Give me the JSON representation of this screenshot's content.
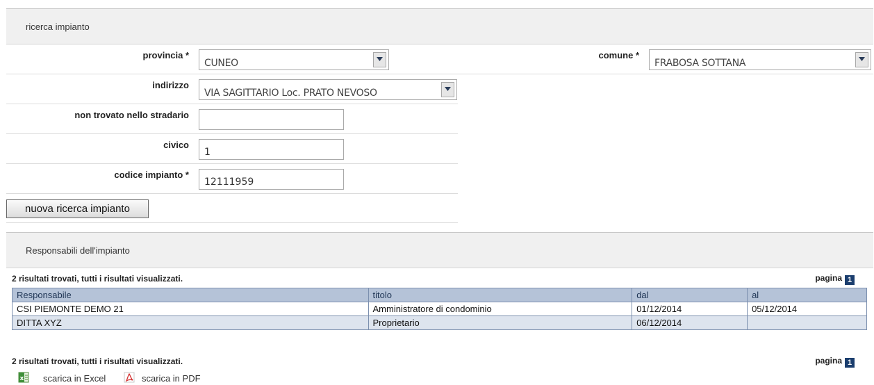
{
  "search": {
    "header": "ricerca impianto",
    "provincia": {
      "label": "provincia *",
      "value": "CUNEO"
    },
    "comune": {
      "label": "comune *",
      "value": "FRABOSA SOTTANA"
    },
    "indirizzo": {
      "label": "indirizzo",
      "value": "VIA SAGITTARIO Loc. PRATO NEVOSO"
    },
    "non_trovato": {
      "label": "non trovato nello stradario",
      "value": ""
    },
    "civico": {
      "label": "civico",
      "value": "1"
    },
    "codice": {
      "label": "codice impianto *",
      "value": "12111959"
    },
    "new_search_button": "nuova ricerca impianto"
  },
  "responsabili": {
    "header": "Responsabili dell'impianto",
    "summary_top": "2 risultati trovati, tutti i risultati visualizzati.",
    "summary_bottom": "2 risultati trovati, tutti i risultati visualizzati.",
    "page_label": "pagina",
    "page_number": "1",
    "columns": [
      "Responsabile",
      "titolo",
      "dal",
      "al"
    ],
    "rows": [
      [
        "CSI PIEMONTE DEMO 21",
        "Amministratore di condominio",
        "01/12/2014",
        "05/12/2014"
      ],
      [
        "DITTA XYZ",
        "Proprietario",
        "06/12/2014",
        ""
      ]
    ]
  },
  "downloads": {
    "excel": {
      "label": "scarica in Excel",
      "icon": "excel-icon"
    },
    "pdf": {
      "label": "scarica in PDF",
      "icon": "pdf-icon"
    }
  },
  "colors": {
    "header_bg": "#f0f0f0",
    "table_header_bg": "#b5c3d8",
    "table_alt_bg": "#dde4ee",
    "page_badge": "#1b3e6e"
  }
}
